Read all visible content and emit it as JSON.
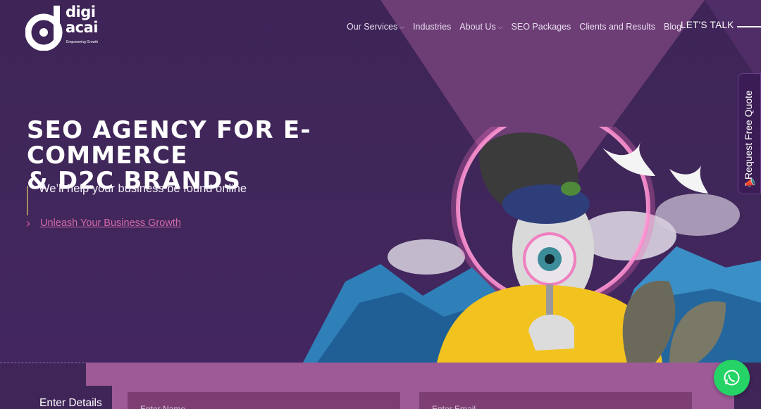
{
  "brand": {
    "name_line1": "digi",
    "name_line2": "acai",
    "tagline": "Empowering Growth"
  },
  "nav": {
    "items": [
      {
        "label": "Our Services",
        "dropdown": true
      },
      {
        "label": "Industries",
        "dropdown": false
      },
      {
        "label": "About Us",
        "dropdown": true
      },
      {
        "label": "SEO Packages",
        "dropdown": false
      },
      {
        "label": "Clients and Results",
        "dropdown": false
      },
      {
        "label": "Blog",
        "dropdown": false
      }
    ],
    "cta": "LET'S TALK"
  },
  "side_tab": {
    "label": "Request Free Quote"
  },
  "hero": {
    "title_line1": "SEO AGENCY FOR E-COMMERCE",
    "title_line2": "& D2C BRANDS",
    "subtitle": "We’ll help your business be found online",
    "cta_link": "Unleash Your Business Growth"
  },
  "form": {
    "label": "Enter Details",
    "name_placeholder": "Enter Name",
    "email_placeholder": "Enter Email"
  },
  "colors": {
    "background": "#3f2558",
    "accent_pink": "#d46aa8",
    "form_panel": "#9d5a96",
    "whatsapp": "#25d366"
  },
  "icons": {
    "nav_dropdown": "chevron-down-icon",
    "cta_arrow": "chevron-right-icon",
    "quote": "megaphone-icon",
    "chat": "whatsapp-icon"
  }
}
